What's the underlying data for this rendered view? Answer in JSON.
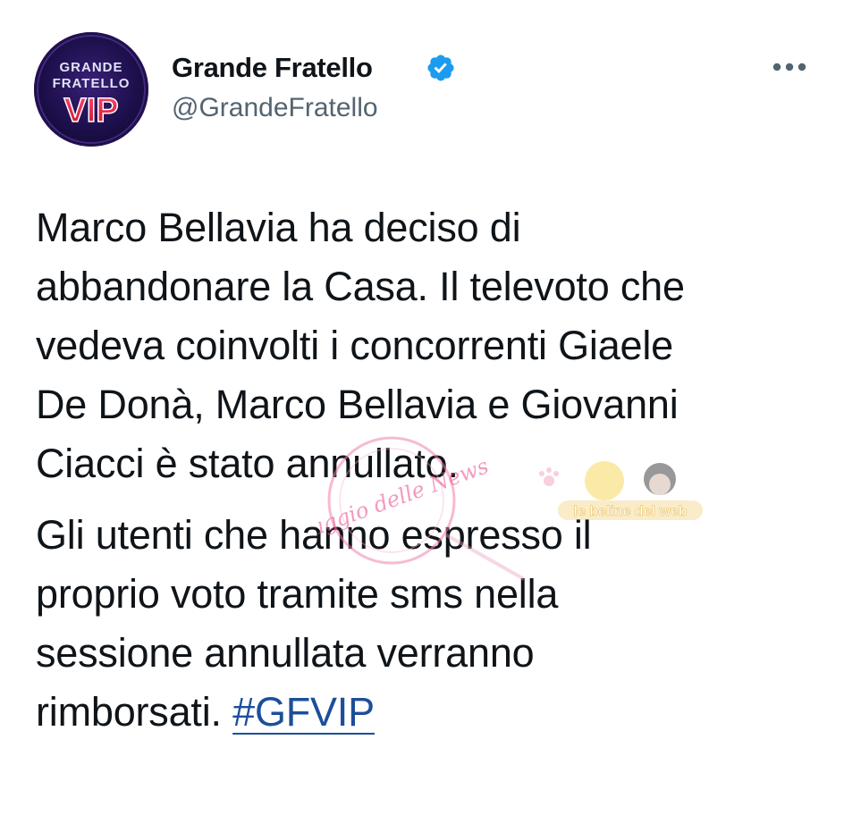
{
  "account": {
    "avatar_lines": [
      "GRANDE",
      "FRATELLO",
      "VIP"
    ],
    "display_name": "Grande Fratello",
    "handle": "@GrandeFratello",
    "verified_icon": "verified-badge-icon",
    "more_icon": "more-horizontal-icon"
  },
  "tweet": {
    "paragraph1": "Marco Bellavia ha deciso di\nabbandonare la Casa. Il televoto che\nvedeva coinvolti i concorrenti Giaele\nDe Donà, Marco Bellavia e Giovanni\nCiacci è stato annullato.",
    "paragraph2": "Gli utenti che hanno espresso il\nproprio voto tramite sms nella\nsessione annullata verranno\nrimborsati. ",
    "hashtag": "#GFVIP"
  },
  "watermark": {
    "logo_text": "Viaggio delle News",
    "banner_text": "le beline del web"
  },
  "colors": {
    "text": "#0f1419",
    "secondary": "#536471",
    "link": "#1d4e9a",
    "verified": "#1d9bf0"
  }
}
